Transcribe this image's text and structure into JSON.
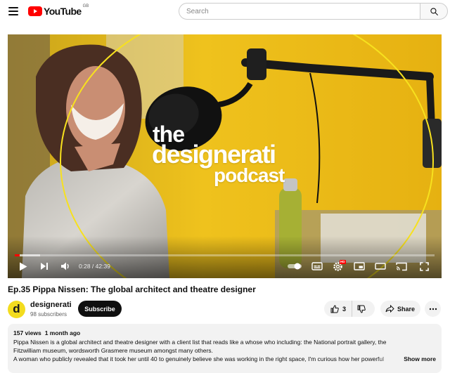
{
  "header": {
    "logo_text": "YouTube",
    "region": "GB",
    "search_placeholder": "Search"
  },
  "player": {
    "overlay_the": "the",
    "overlay_designerati": "designerati",
    "overlay_podcast": "podcast",
    "current_time": "0:28",
    "duration": "42:39",
    "time_display": "0:28 / 42:39",
    "progress_fraction": 0.011,
    "buffered_fraction": 0.06,
    "settings_badge": "HD"
  },
  "video": {
    "title": "Ep.35 Pippa Nissen: The global architect and theatre designer"
  },
  "channel": {
    "avatar_letter": "d",
    "name": "designerati",
    "subscribers": "98 subscribers",
    "subscribe_label": "Subscribe"
  },
  "actions": {
    "like_count": "3",
    "share_label": "Share"
  },
  "description": {
    "views": "157 views",
    "age": "1 month ago",
    "line1": "Pippa Nissen is a global architect and theatre designer with a client list that reads like a whose who including: the National portrait gallery, the",
    "line2": "Fitzwilliam museum, wordsworth Grasmere museum amongst many others.",
    "line3": "A woman who publicly revealed that it took her until 40 to genuinely believe she was working in the right space, I'm curious how her powerful",
    "show_more": "Show more"
  },
  "colors": {
    "brand_red": "#ff0000",
    "background_yellow": "#e8b618",
    "avatar_yellow": "#f3dc1e"
  }
}
